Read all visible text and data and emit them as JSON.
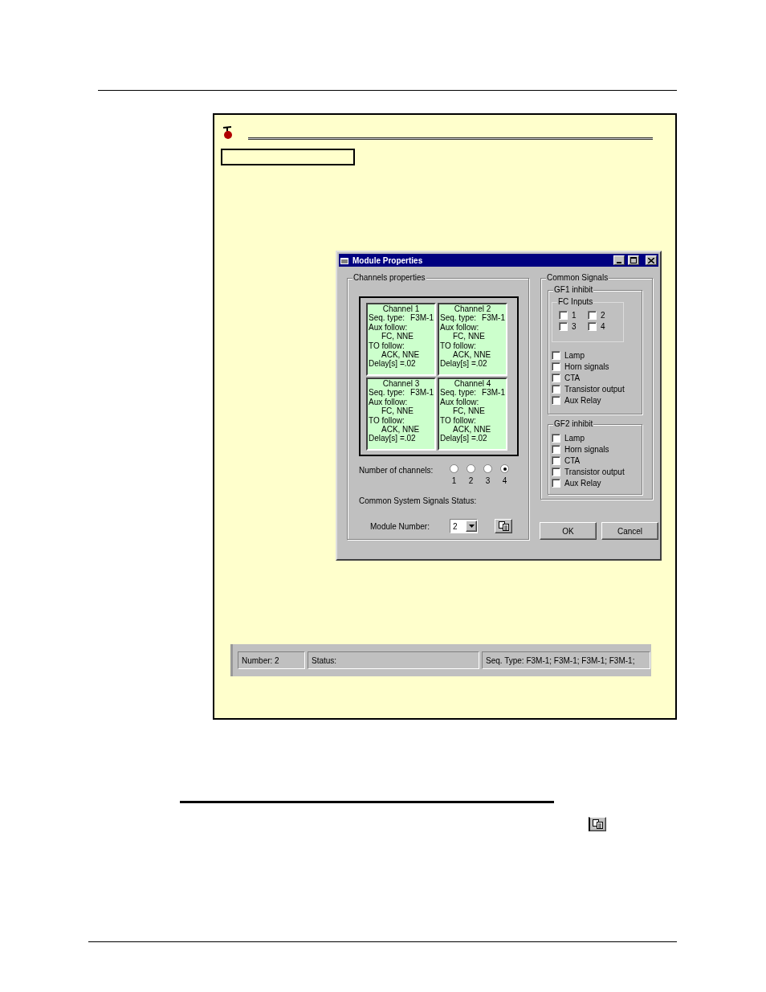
{
  "dialog": {
    "title": "Module Properties",
    "channels_group": {
      "label": "Channels properties",
      "channels": [
        {
          "title": "Channel  1",
          "seq_type_label": "Seq. type:",
          "seq_type": "F3M-1",
          "aux_follow_label": "Aux follow:",
          "aux_follow": "FC, NNE",
          "to_follow_label": "TO follow:",
          "to_follow": "ACK, NNE",
          "delay": "Delay[s] =.02"
        },
        {
          "title": "Channel  2",
          "seq_type_label": "Seq. type:",
          "seq_type": "F3M-1",
          "aux_follow_label": "Aux follow:",
          "aux_follow": "FC, NNE",
          "to_follow_label": "TO follow:",
          "to_follow": "ACK, NNE",
          "delay": "Delay[s] =.02"
        },
        {
          "title": "Channel  3",
          "seq_type_label": "Seq. type:",
          "seq_type": "F3M-1",
          "aux_follow_label": "Aux follow:",
          "aux_follow": "FC, NNE",
          "to_follow_label": "TO follow:",
          "to_follow": "ACK, NNE",
          "delay": "Delay[s] =.02"
        },
        {
          "title": "Channel  4",
          "seq_type_label": "Seq. type:",
          "seq_type": "F3M-1",
          "aux_follow_label": "Aux follow:",
          "aux_follow": "FC, NNE",
          "to_follow_label": "TO follow:",
          "to_follow": "ACK, NNE",
          "delay": "Delay[s] =.02"
        }
      ],
      "number_of_channels": {
        "label": "Number of channels:",
        "options": [
          {
            "label": "1",
            "selected": false
          },
          {
            "label": "2",
            "selected": false
          },
          {
            "label": "3",
            "selected": false
          },
          {
            "label": "4",
            "selected": true
          }
        ]
      },
      "status_label": "Common System Signals Status:",
      "module_number": {
        "label": "Module Number:",
        "value": "2"
      }
    },
    "common_signals": {
      "label": "Common  Signals",
      "gf1": {
        "label": "GF1 inhibit",
        "fc_inputs": {
          "label": "FC Inputs",
          "items": [
            {
              "label": "1",
              "checked": false
            },
            {
              "label": "2",
              "checked": false
            },
            {
              "label": "3",
              "checked": false
            },
            {
              "label": "4",
              "checked": false
            }
          ]
        },
        "items": [
          {
            "label": "Lamp",
            "checked": false
          },
          {
            "label": "Horn signals",
            "checked": false
          },
          {
            "label": "CTA",
            "checked": false
          },
          {
            "label": "Transistor output",
            "checked": false
          },
          {
            "label": "Aux Relay",
            "checked": false
          }
        ]
      },
      "gf2": {
        "label": "GF2 inhibit",
        "items": [
          {
            "label": "Lamp",
            "checked": false
          },
          {
            "label": "Horn signals",
            "checked": false
          },
          {
            "label": "CTA",
            "checked": false
          },
          {
            "label": "Transistor output",
            "checked": false
          },
          {
            "label": "Aux Relay",
            "checked": false
          }
        ]
      }
    },
    "buttons": [
      "OK",
      "Cancel"
    ]
  },
  "status_bar": {
    "panels": [
      "Number:  2",
      "Status:",
      "Seq. Type:  F3M-1;  F3M-1;  F3M-1;  F3M-1;"
    ]
  }
}
